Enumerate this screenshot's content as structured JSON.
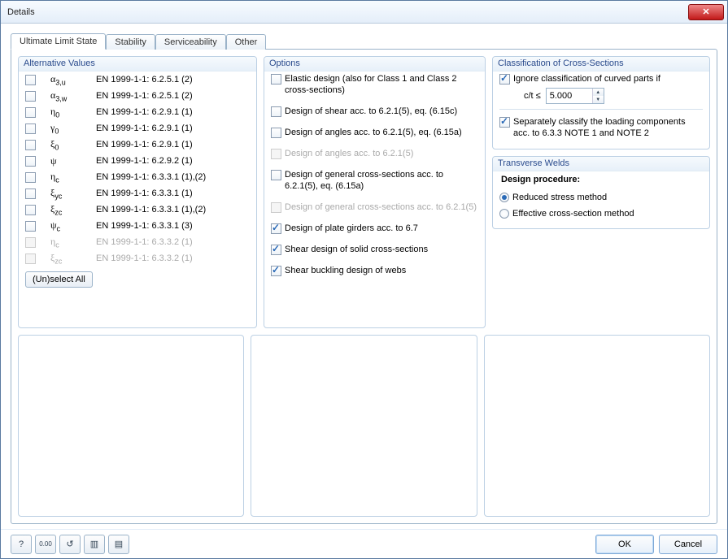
{
  "window": {
    "title": "Details"
  },
  "tabs": [
    {
      "label": "Ultimate Limit State"
    },
    {
      "label": "Stability"
    },
    {
      "label": "Serviceability"
    },
    {
      "label": "Other"
    }
  ],
  "altValues": {
    "title": "Alternative Values",
    "rows": [
      {
        "sym": "α<sub>3,u</sub>",
        "ref": "EN  1999-1-1: 6.2.5.1 (2)",
        "disabled": false
      },
      {
        "sym": "α<sub>3,w</sub>",
        "ref": "EN  1999-1-1: 6.2.5.1 (2)",
        "disabled": false
      },
      {
        "sym": "η<sub>0</sub>",
        "ref": "EN  1999-1-1: 6.2.9.1 (1)",
        "disabled": false
      },
      {
        "sym": "γ<sub>0</sub>",
        "ref": "EN  1999-1-1: 6.2.9.1 (1)",
        "disabled": false
      },
      {
        "sym": "ξ<sub>0</sub>",
        "ref": "EN  1999-1-1: 6.2.9.1 (1)",
        "disabled": false
      },
      {
        "sym": "ψ",
        "ref": "EN  1999-1-1: 6.2.9.2 (1)",
        "disabled": false
      },
      {
        "sym": "η<sub>c</sub>",
        "ref": "EN  1999-1-1: 6.3.3.1 (1),(2)",
        "disabled": false
      },
      {
        "sym": "ξ<sub>yc</sub>",
        "ref": "EN  1999-1-1: 6.3.3.1 (1)",
        "disabled": false
      },
      {
        "sym": "ξ<sub>zc</sub>",
        "ref": "EN  1999-1-1: 6.3.3.1 (1),(2)",
        "disabled": false
      },
      {
        "sym": "ψ<sub>c</sub>",
        "ref": "EN  1999-1-1: 6.3.3.1 (3)",
        "disabled": false
      },
      {
        "sym": "η<sub>c</sub>",
        "ref": "EN  1999-1-1: 6.3.3.2 (1)",
        "disabled": true
      },
      {
        "sym": "ξ<sub>zc</sub>",
        "ref": "EN  1999-1-1: 6.3.3.2 (1)",
        "disabled": true
      }
    ],
    "unselect": "(Un)select All"
  },
  "options": {
    "title": "Options",
    "rows": [
      {
        "text": "Elastic design (also for Class 1 and Class 2 cross-sections)",
        "checked": false,
        "disabled": false
      },
      {
        "text": "Design of shear acc. to 6.2.1(5), eq. (6.15c)",
        "checked": false,
        "disabled": false
      },
      {
        "text": "Design of angles acc. to 6.2.1(5), eq. (6.15a)",
        "checked": false,
        "disabled": false
      },
      {
        "text": "Design of angles acc. to 6.2.1(5)",
        "checked": false,
        "disabled": true
      },
      {
        "text": "Design of general cross-sections acc. to 6.2.1(5), eq. (6.15a)",
        "checked": false,
        "disabled": false
      },
      {
        "text": "Design of general cross-sections acc. to 6.2.1(5)",
        "checked": false,
        "disabled": true
      },
      {
        "text": "Design of plate girders acc. to 6.7",
        "checked": true,
        "disabled": false
      },
      {
        "text": "Shear design of solid cross-sections",
        "checked": true,
        "disabled": false
      },
      {
        "text": "Shear buckling design of webs",
        "checked": true,
        "disabled": false
      }
    ]
  },
  "classification": {
    "title": "Classification of Cross-Sections",
    "ignore": {
      "label": "Ignore classification of curved parts if",
      "checked": true
    },
    "ct_label": "c/t ≤",
    "ct_value": "5.000",
    "separately": {
      "label": "Separately classify the loading components acc. to 6.3.3 NOTE 1 and NOTE 2",
      "checked": true
    }
  },
  "transverse": {
    "title": "Transverse Welds",
    "procedure_label": "Design procedure:",
    "opt1": "Reduced stress method",
    "opt2": "Effective cross-section method"
  },
  "footer": {
    "ok": "OK",
    "cancel": "Cancel"
  }
}
